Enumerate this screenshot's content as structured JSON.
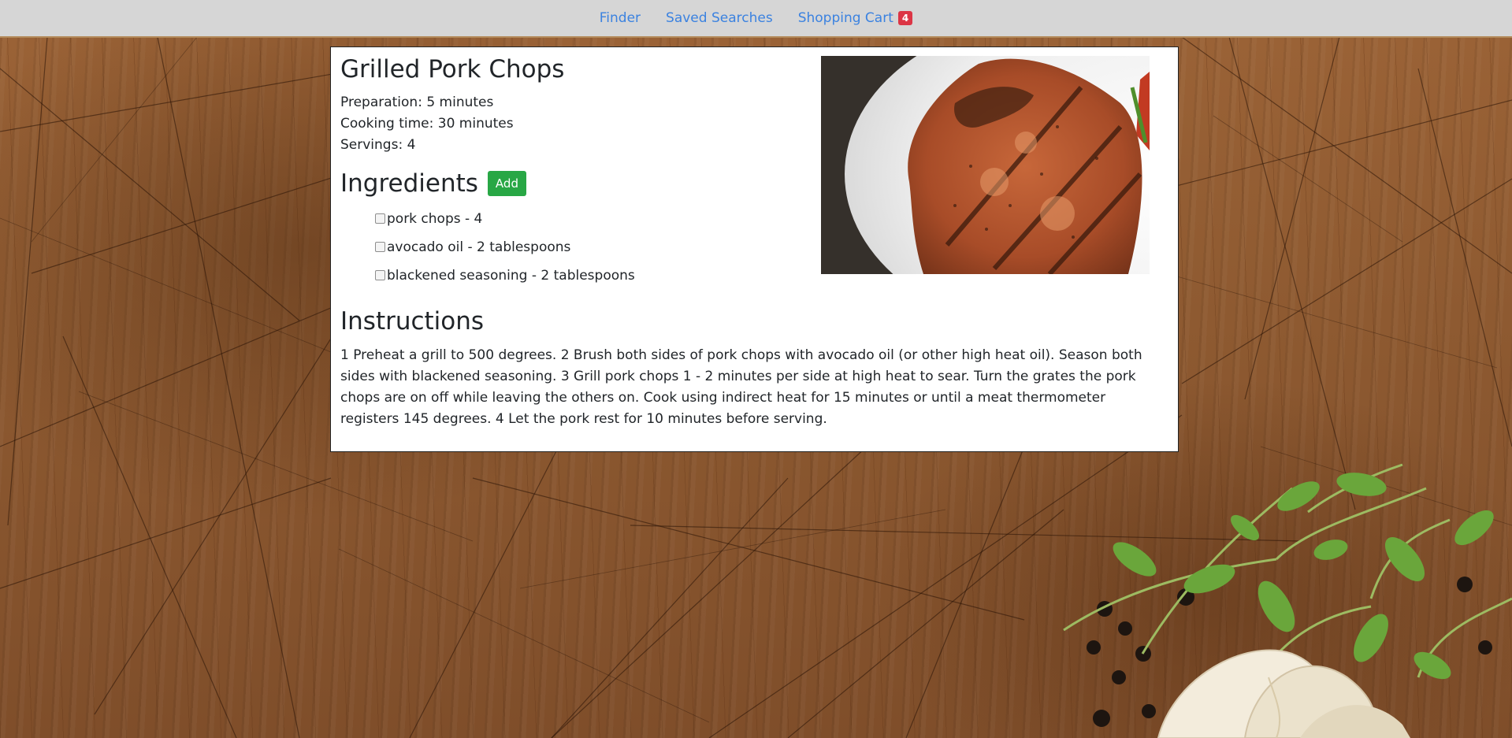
{
  "nav": {
    "links": [
      "Finder",
      "Saved Searches",
      "Shopping Cart"
    ],
    "cart_count": "4"
  },
  "recipe": {
    "title": "Grilled Pork Chops",
    "preparation": "Preparation: 5 minutes",
    "cooking_time": "Cooking time: 30 minutes",
    "servings": "Servings: 4",
    "ingredients_heading": "Ingredients",
    "add_label": "Add",
    "ingredients": [
      "pork chops - 4",
      "avocado oil - 2 tablespoons",
      "blackened seasoning - 2 tablespoons"
    ],
    "instructions_heading": "Instructions",
    "instructions": "1 Preheat a grill to 500 degrees. 2 Brush both sides of pork chops with avocado oil (or other high heat oil). Season both sides with blackened seasoning. 3 Grill pork chops 1 - 2 minutes per side at high heat to sear. Turn the grates the pork chops are on off while leaving the others on. Cook using indirect heat for 15 minutes or until a meat thermometer registers 145 degrees. 4 Let the pork rest for 10 minutes before serving."
  },
  "colors": {
    "link": "#3b82e0",
    "badge": "#dc3545",
    "add_button": "#28a745",
    "nav_bg": "#d6d6d6"
  }
}
